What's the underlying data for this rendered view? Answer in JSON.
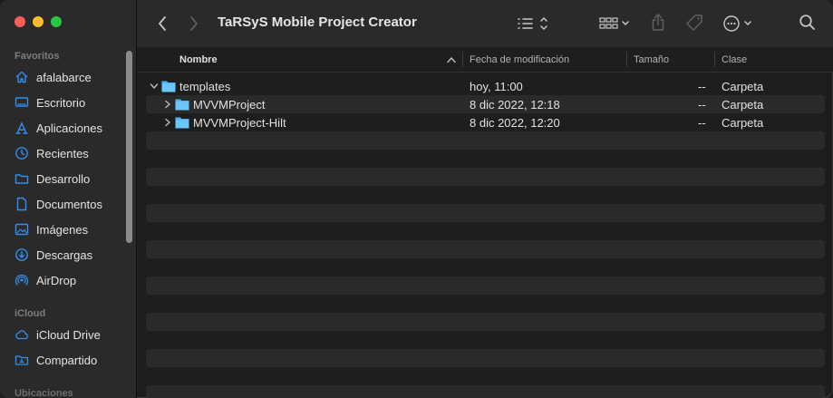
{
  "window": {
    "title": "TaRSyS Mobile Project Creator"
  },
  "sidebar": {
    "favorites_title": "Favoritos",
    "favorites": [
      {
        "label": "afalabarce",
        "icon": "home-icon"
      },
      {
        "label": "Escritorio",
        "icon": "desktop-icon"
      },
      {
        "label": "Aplicaciones",
        "icon": "applications-icon"
      },
      {
        "label": "Recientes",
        "icon": "clock-icon"
      },
      {
        "label": "Desarrollo",
        "icon": "folder-icon"
      },
      {
        "label": "Documentos",
        "icon": "document-icon"
      },
      {
        "label": "Imágenes",
        "icon": "photo-icon"
      },
      {
        "label": "Descargas",
        "icon": "download-icon"
      },
      {
        "label": "AirDrop",
        "icon": "airdrop-icon"
      }
    ],
    "icloud_title": "iCloud",
    "icloud": [
      {
        "label": "iCloud Drive",
        "icon": "cloud-icon"
      },
      {
        "label": "Compartido",
        "icon": "shared-folder-icon"
      }
    ],
    "locations_title": "Ubicaciones"
  },
  "columns": {
    "name": "Nombre",
    "modified": "Fecha de modificación",
    "size": "Tamaño",
    "kind": "Clase"
  },
  "files": [
    {
      "name": "templates",
      "date": "hoy, 11:00",
      "size": "--",
      "kind": "Carpeta",
      "expanded": true,
      "level": 0
    },
    {
      "name": "MVVMProject",
      "date": "8 dic 2022, 12:18",
      "size": "--",
      "kind": "Carpeta",
      "expanded": false,
      "level": 1
    },
    {
      "name": "MVVMProject-Hilt",
      "date": "8 dic 2022, 12:20",
      "size": "--",
      "kind": "Carpeta",
      "expanded": false,
      "level": 1
    }
  ],
  "colors": {
    "accent": "#1d9bf0",
    "folder": "#4cb6f5",
    "sidebar_bg": "#2b2a2a",
    "content_bg": "#1e1e1e",
    "stripe": "#2a2a2a"
  }
}
